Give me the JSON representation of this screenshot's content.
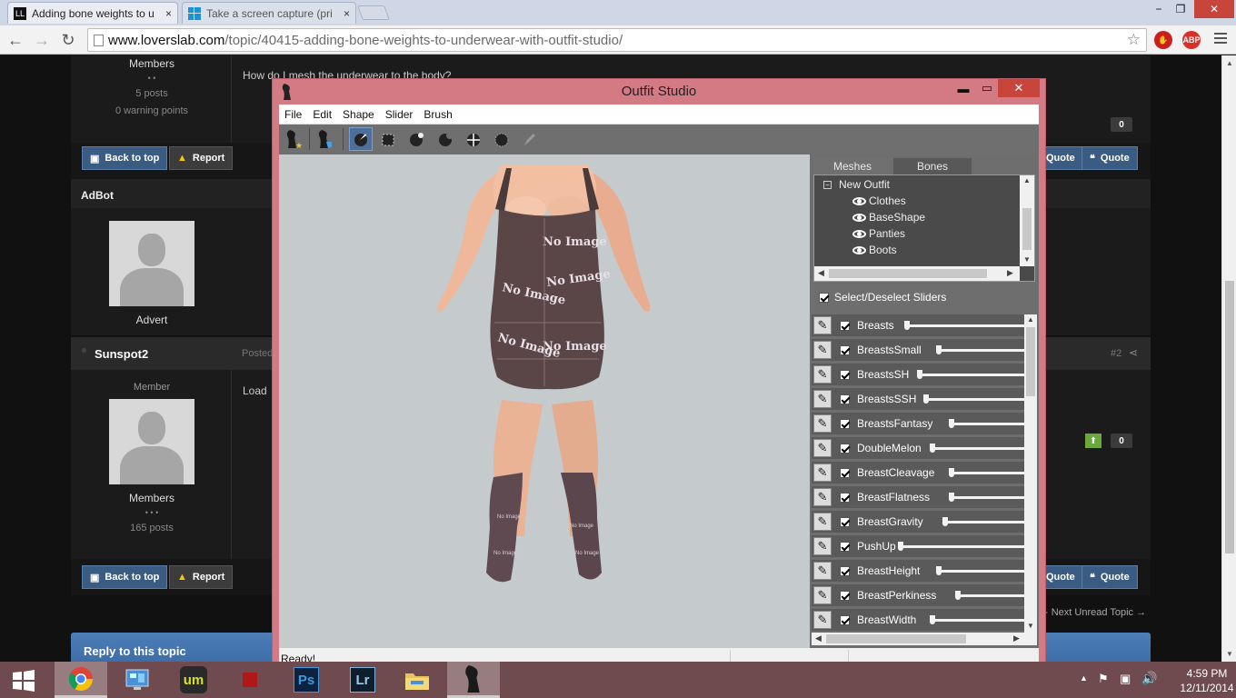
{
  "browser": {
    "tabs": [
      {
        "title": "Adding bone weights to u",
        "close": "×"
      },
      {
        "title": "Take a screen capture (pri",
        "close": "×"
      }
    ],
    "url_host": "www.loverslab.com",
    "url_path": "/topic/40415-adding-bone-weights-to-underwear-with-outfit-studio/",
    "window_controls": {
      "minimize": "−",
      "restore": "❐",
      "close": "✕"
    },
    "extensions": [
      {
        "label": "ABP"
      }
    ]
  },
  "forum": {
    "post1": {
      "rank": "Members",
      "posts": "5 posts",
      "warnings": "0 warning points",
      "text": "How do I mesh the underwear to the body?",
      "rep": "0"
    },
    "buttons": {
      "back_to_top": "Back to top",
      "report": "Report",
      "multiquote": "Quote",
      "quote": "Quote"
    },
    "adbot": {
      "name": "AdBot",
      "role": "Advert"
    },
    "post2": {
      "author": "Sunspot2",
      "posted": "Posted",
      "number": "#2",
      "member": "Member",
      "rank": "Members",
      "posts": "165 posts",
      "text": "Load",
      "rep": "0"
    },
    "next_unread": "Next Unread Topic",
    "reply_title": "Reply to this topic"
  },
  "outfit_studio": {
    "title": "Outfit Studio",
    "controls": {
      "minimize": "▬",
      "maximize": "▭",
      "close": "✕"
    },
    "menus": [
      "File",
      "Edit",
      "Shape",
      "Slider",
      "Brush"
    ],
    "tabs": {
      "meshes": "Meshes",
      "bones": "Bones"
    },
    "tree": {
      "root": "New Outfit",
      "items": [
        "Clothes",
        "BaseShape",
        "Panties",
        "Boots"
      ]
    },
    "select_all": "Select/Deselect Sliders",
    "sliders": [
      {
        "name": "Breasts",
        "value": 0.0
      },
      {
        "name": "BreastsSmall",
        "value": 0.0
      },
      {
        "name": "BreastsSH",
        "value": 0.0
      },
      {
        "name": "BreastsSSH",
        "value": 0.0
      },
      {
        "name": "BreastsFantasy",
        "value": 0.0
      },
      {
        "name": "DoubleMelon",
        "value": 0.0
      },
      {
        "name": "BreastCleavage",
        "value": 0.0
      },
      {
        "name": "BreastFlatness",
        "value": 0.0
      },
      {
        "name": "BreastGravity",
        "value": 0.0
      },
      {
        "name": "PushUp",
        "value": 0.0
      },
      {
        "name": "BreastHeight",
        "value": 0.0
      },
      {
        "name": "BreastPerkiness",
        "value": 0.0
      },
      {
        "name": "BreastWidth",
        "value": 0.0
      }
    ],
    "status": "Ready!",
    "model_texture_text": "No Image"
  },
  "taskbar": {
    "apps": [
      "chrome-icon",
      "control-panel-icon",
      "um-icon",
      "red-square-icon",
      "photoshop-icon",
      "lightroom-icon",
      "file-explorer-icon",
      "outfit-studio-icon"
    ],
    "ps_label": "Ps",
    "lr_label": "Lr",
    "time": "4:59 PM",
    "date": "12/11/2014"
  },
  "colors": {
    "os_frame": "#d47a85",
    "taskbar": "#6f4b4f",
    "forum_button": "#3a5c82",
    "toolbar_active": "#4d6f9a"
  }
}
